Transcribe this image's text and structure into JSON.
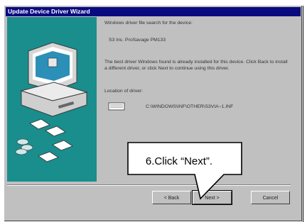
{
  "window": {
    "title": "Update Device Driver Wizard"
  },
  "content": {
    "line1": "Windows driver file search for the device:",
    "device": "S3 Inc. ProSavage PM133",
    "desc": "The best driver Windows found is already installed for this device. Click Back to install a different driver, or click Next to continue using this driver.",
    "location_label": "Location of driver:",
    "location_path": "C:\\WINDOWS\\INF\\OTHER\\S3VIA~1.INF"
  },
  "buttons": {
    "back": "< Back",
    "next": "Next >",
    "cancel": "Cancel"
  },
  "callout": {
    "text": "6.Click “Next”."
  },
  "colors": {
    "titlebar": "#0a0a80",
    "teal": "#1a8d8d",
    "face": "#c0c0c0"
  }
}
